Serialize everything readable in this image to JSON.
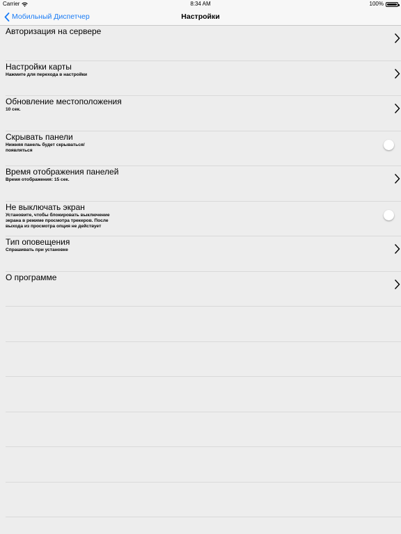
{
  "status": {
    "carrier": "Carrier",
    "time": "8:34 AM",
    "battery": "100%"
  },
  "nav": {
    "back_label": "Мобильный Диспетчер",
    "title": "Настройки"
  },
  "rows": [
    {
      "title": "Авторизация на сервере",
      "subtitle": "",
      "accessory": "chevron"
    },
    {
      "title": "Настройки карты",
      "subtitle": "Нажмите для перехода в настройки",
      "accessory": "chevron"
    },
    {
      "title": "Обновление местоположения",
      "subtitle": "10 сек.",
      "accessory": "chevron"
    },
    {
      "title": "Скрывать панели",
      "subtitle": "Нижняя панель будет скрываться/ появляться",
      "accessory": "toggle",
      "toggle_on": false
    },
    {
      "title": "Время отображения панелей",
      "subtitle": "Время отображения: 15 сек.",
      "accessory": "chevron"
    },
    {
      "title": "Не выключать экран",
      "subtitle": "Установите, чтобы блокировать выключение экрана в режиме просмотра трекеров. После выхода из просмотра опция не действует",
      "accessory": "toggle",
      "toggle_on": false
    },
    {
      "title": "Тип оповещения",
      "subtitle": "Спрашивать при установке",
      "accessory": "chevron"
    },
    {
      "title": "О программе",
      "subtitle": "",
      "accessory": "chevron"
    }
  ],
  "colors": {
    "accent": "#1a7cf6",
    "background": "#ededed",
    "separator": "#d9d9d9"
  },
  "icons": {
    "wifi": "wifi-icon",
    "battery": "battery-icon",
    "back": "chevron-left-icon",
    "disclosure": "chevron-right-icon"
  }
}
